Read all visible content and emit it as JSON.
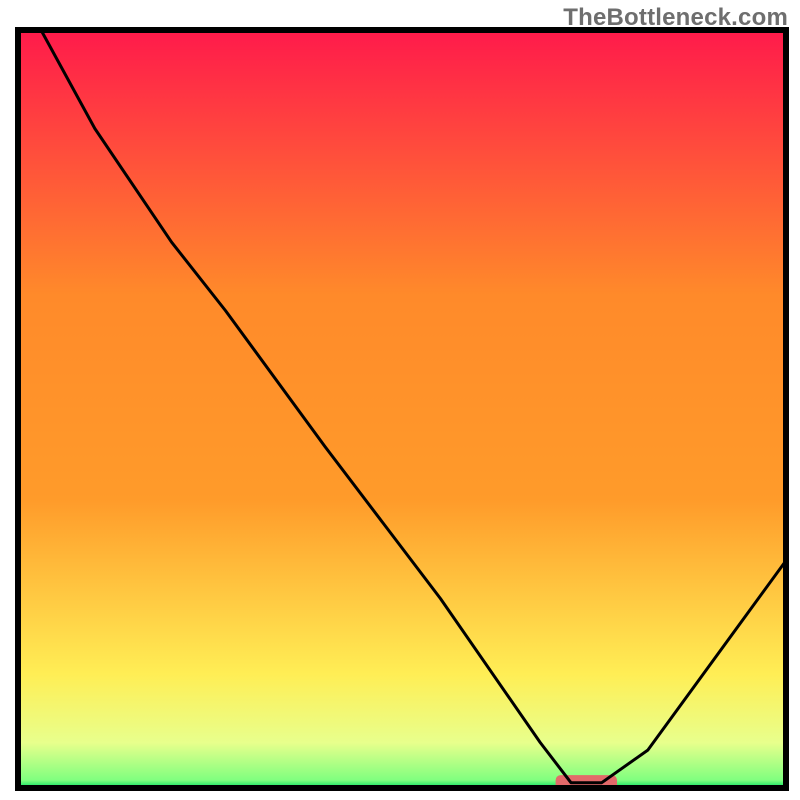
{
  "watermark": "TheBottleneck.com",
  "chart_data": {
    "type": "line",
    "title": "",
    "xlabel": "",
    "ylabel": "",
    "xlim": [
      0,
      100
    ],
    "ylim": [
      0,
      100
    ],
    "grid": false,
    "legend": false,
    "annotations": [],
    "gradient_colors": {
      "top": "#ff1a4b",
      "upper_mid": "#ff9b2a",
      "lower_mid": "#ffee55",
      "near_bottom": "#e8ff8c",
      "bottom": "#00e060"
    },
    "series": [
      {
        "name": "bottleneck-curve",
        "color": "#000000",
        "x": [
          3,
          10,
          20,
          27,
          40,
          55,
          68,
          72,
          76,
          82,
          100
        ],
        "y": [
          100,
          87,
          72,
          63,
          45,
          25,
          6,
          0.7,
          0.7,
          5,
          30
        ]
      }
    ],
    "marker": {
      "name": "highlight-marker",
      "color": "#e26a6a",
      "x_center": 74,
      "x_half_width": 4,
      "y": 0.5,
      "height": 1.2
    },
    "frame": {
      "stroke": "#000000",
      "stroke_width": 6
    }
  }
}
